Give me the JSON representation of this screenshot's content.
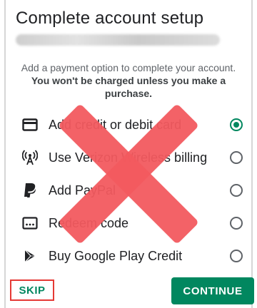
{
  "dialog": {
    "title": "Complete account setup",
    "intro_text": "Add a payment option to complete your account.",
    "intro_bold": "You won't be charged unless you make a purchase."
  },
  "options": [
    {
      "label": "Add credit or debit card",
      "icon": "credit-card-icon",
      "selected": true
    },
    {
      "label": "Use Verizon Wireless billing",
      "icon": "cell-tower-icon",
      "selected": false
    },
    {
      "label": "Add PayPal",
      "icon": "paypal-icon",
      "selected": false
    },
    {
      "label": "Redeem code",
      "icon": "redeem-code-icon",
      "selected": false
    },
    {
      "label": "Buy Google Play Credit",
      "icon": "google-play-icon",
      "selected": false
    }
  ],
  "actions": {
    "skip_label": "SKIP",
    "continue_label": "CONTINUE"
  },
  "colors": {
    "accent_green": "#01875f",
    "cross_red": "#f25a5f",
    "highlight_red": "#e53935"
  }
}
